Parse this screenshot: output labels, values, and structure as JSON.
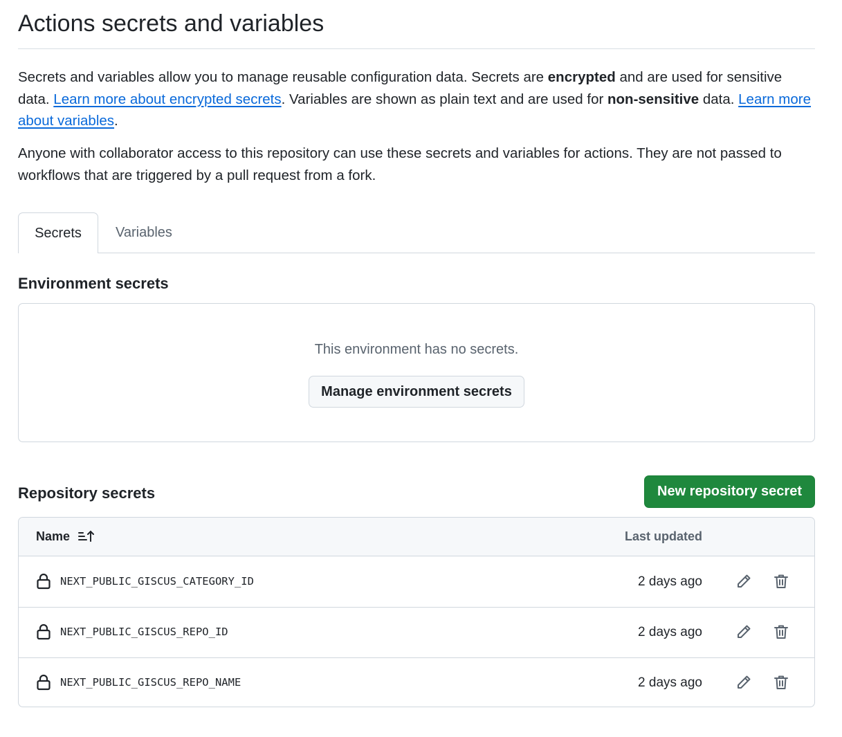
{
  "page": {
    "title": "Actions secrets and variables"
  },
  "intro": {
    "p1_a": "Secrets and variables allow you to manage reusable configuration data. Secrets are ",
    "p1_bold1": "encrypted",
    "p1_b": " and are used for sensitive data. ",
    "p1_link1": "Learn more about encrypted secrets",
    "p1_c": ". Variables are shown as plain text and are used for ",
    "p1_bold2": "non-sensitive",
    "p1_d": " data. ",
    "p1_link2": "Learn more about variables",
    "p1_e": ".",
    "p2": "Anyone with collaborator access to this repository can use these secrets and variables for actions. They are not passed to workflows that are triggered by a pull request from a fork."
  },
  "tabs": [
    {
      "label": "Secrets",
      "selected": true
    },
    {
      "label": "Variables",
      "selected": false
    }
  ],
  "environment_secrets": {
    "heading": "Environment secrets",
    "empty_message": "This environment has no secrets.",
    "manage_button": "Manage environment secrets"
  },
  "repository_secrets": {
    "heading": "Repository secrets",
    "new_button": "New repository secret",
    "columns": {
      "name": "Name",
      "last_updated": "Last updated"
    },
    "rows": [
      {
        "name": "NEXT_PUBLIC_GISCUS_CATEGORY_ID",
        "updated": "2 days ago"
      },
      {
        "name": "NEXT_PUBLIC_GISCUS_REPO_ID",
        "updated": "2 days ago"
      },
      {
        "name": "NEXT_PUBLIC_GISCUS_REPO_NAME",
        "updated": "2 days ago"
      }
    ]
  },
  "icons": {
    "sort": "sort-ascending-icon",
    "lock": "lock-icon",
    "edit": "pencil-icon",
    "delete": "trash-icon"
  },
  "colors": {
    "link": "#0969da",
    "primary_button": "#1f883d",
    "border": "#d0d7de",
    "text": "#1f2328",
    "muted": "#59636e"
  }
}
